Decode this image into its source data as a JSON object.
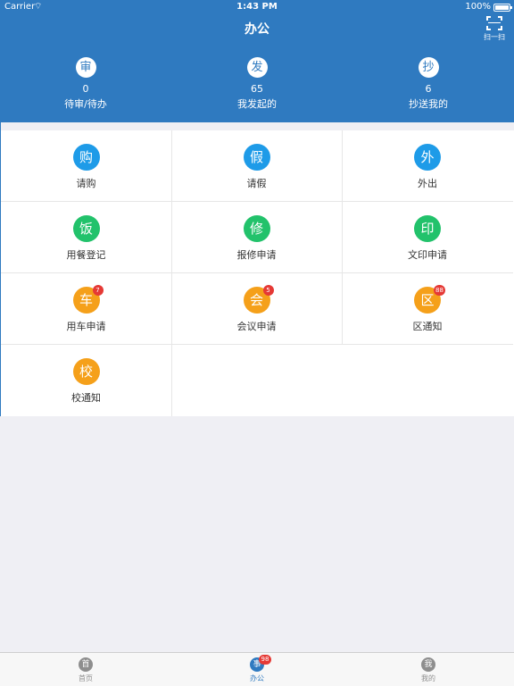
{
  "status_bar": {
    "carrier": "Carrier",
    "time": "1:43 PM",
    "battery": "100%"
  },
  "nav": {
    "title": "办公",
    "scan_label": "扫一扫"
  },
  "summary": [
    {
      "icon_char": "审",
      "count": "0",
      "label": "待审/待办"
    },
    {
      "icon_char": "发",
      "count": "65",
      "label": "我发起的"
    },
    {
      "icon_char": "抄",
      "count": "6",
      "label": "抄送我的"
    }
  ],
  "grid": [
    {
      "icon_char": "购",
      "label": "请购",
      "color": "#1e9be8",
      "badge": ""
    },
    {
      "icon_char": "假",
      "label": "请假",
      "color": "#1e9be8",
      "badge": ""
    },
    {
      "icon_char": "外",
      "label": "外出",
      "color": "#1e9be8",
      "badge": ""
    },
    {
      "icon_char": "饭",
      "label": "用餐登记",
      "color": "#22c26b",
      "badge": ""
    },
    {
      "icon_char": "修",
      "label": "报修申请",
      "color": "#22c26b",
      "badge": ""
    },
    {
      "icon_char": "印",
      "label": "文印申请",
      "color": "#22c26b",
      "badge": ""
    },
    {
      "icon_char": "车",
      "label": "用车申请",
      "color": "#f5a01a",
      "badge": "7"
    },
    {
      "icon_char": "会",
      "label": "会议申请",
      "color": "#f5a01a",
      "badge": "5"
    },
    {
      "icon_char": "区",
      "label": "区通知",
      "color": "#f5a01a",
      "badge": "88"
    },
    {
      "icon_char": "校",
      "label": "校通知",
      "color": "#f5a01a",
      "badge": ""
    }
  ],
  "tabs": [
    {
      "icon_char": "首",
      "label": "首页",
      "badge": ""
    },
    {
      "icon_char": "事",
      "label": "办公",
      "badge": "98"
    },
    {
      "icon_char": "我",
      "label": "我的",
      "badge": ""
    }
  ],
  "colors": {
    "header": "#2f7ac0",
    "blue": "#1e9be8",
    "green": "#22c26b",
    "orange": "#f5a01a",
    "badge": "#e53935"
  }
}
